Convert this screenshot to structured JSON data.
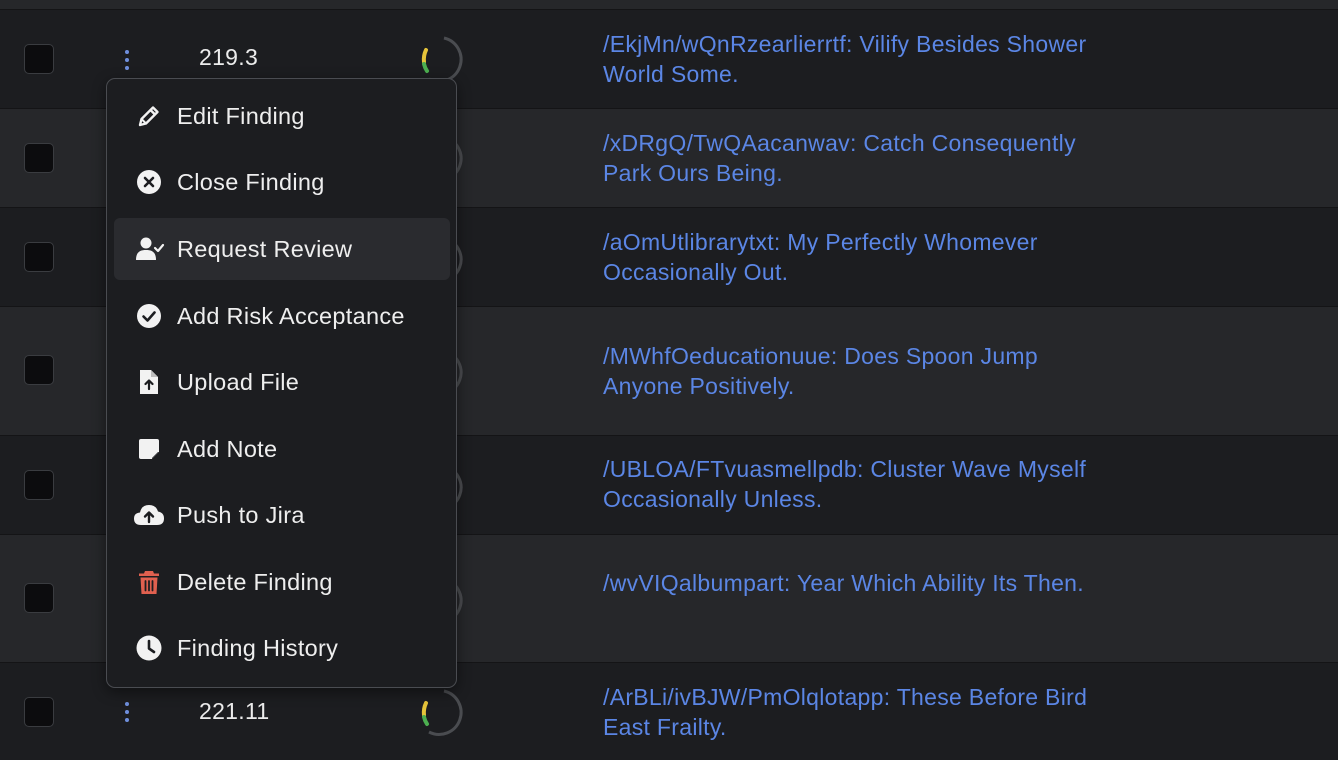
{
  "table": {
    "rows": [
      {
        "score": "219.3",
        "title": "/EkjMn/wQnRzearlierrtf: Vilify Besides Shower World Some."
      },
      {
        "score": "",
        "title": "/xDRgQ/TwQAacanwav: Catch Consequently Park Ours Being."
      },
      {
        "score": "",
        "title": "/aOmUtlibrarytxt: My Perfectly Whomever Occasionally Out."
      },
      {
        "score": "",
        "title": "/MWhfOeducationuue: Does Spoon Jump Anyone Positively."
      },
      {
        "score": "",
        "title": "/UBLOA/FTvuasmellpdb: Cluster Wave Myself Occasionally Unless."
      },
      {
        "score": "",
        "title": "/wvVIQalbumpart: Year Which Ability Its Then."
      },
      {
        "score": "221.11",
        "title": "/ArBLi/ivBJW/PmOlqlotapp: These Before Bird East Frailty."
      }
    ]
  },
  "menu": {
    "items": [
      {
        "label": "Edit Finding",
        "icon": "pencil-icon"
      },
      {
        "label": "Close Finding",
        "icon": "close-circle-icon"
      },
      {
        "label": "Request Review",
        "icon": "user-check-icon"
      },
      {
        "label": "Add Risk Acceptance",
        "icon": "check-circle-icon"
      },
      {
        "label": "Upload File",
        "icon": "file-upload-icon"
      },
      {
        "label": "Add Note",
        "icon": "note-icon"
      },
      {
        "label": "Push to Jira",
        "icon": "cloud-upload-icon"
      },
      {
        "label": "Delete Finding",
        "icon": "trash-icon"
      },
      {
        "label": "Finding History",
        "icon": "clock-icon"
      }
    ],
    "hovered_item": "Request Review"
  },
  "colors": {
    "link": "#5b86e5",
    "kebab": "#6f8fdc",
    "delete_icon": "#e0604f",
    "gauge_yellow": "#e6c43a",
    "gauge_green": "#4caf50"
  }
}
